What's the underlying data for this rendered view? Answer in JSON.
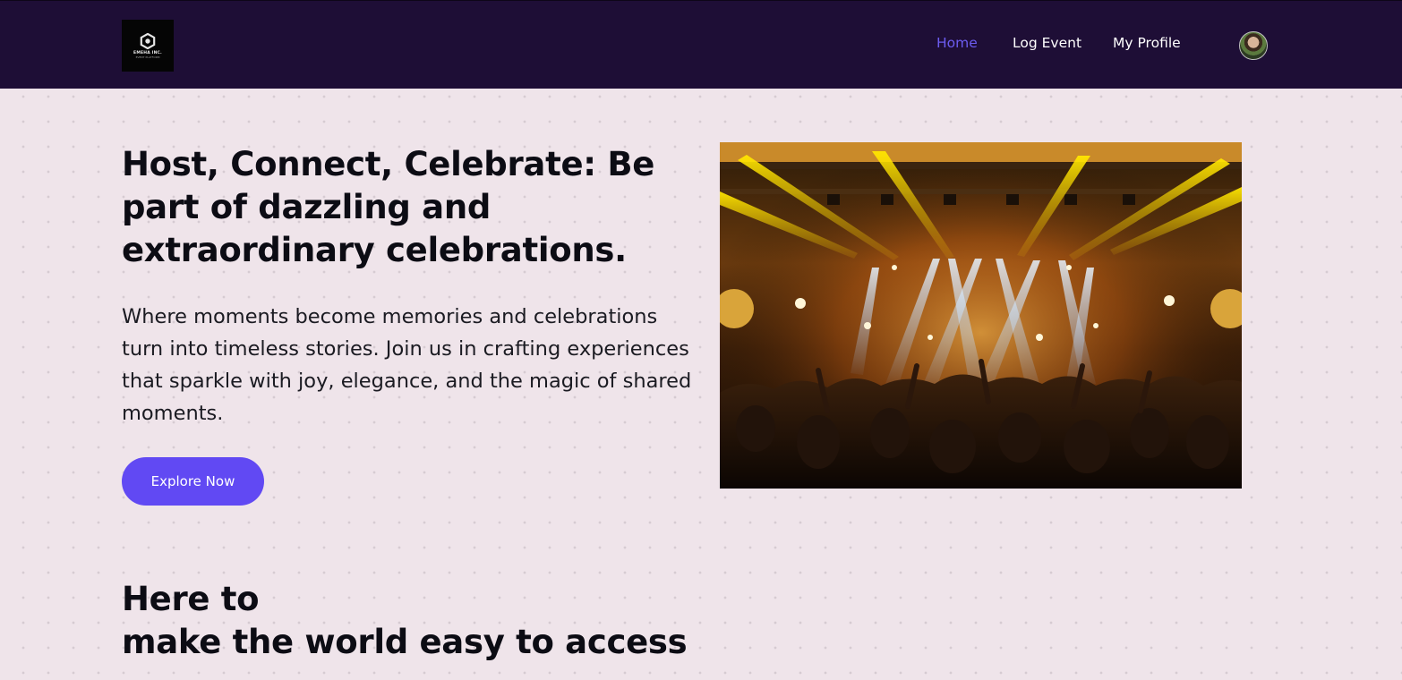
{
  "brand": {
    "logo_name": "EMEHA INC.",
    "logo_tagline": "EVENT PLATFORM"
  },
  "nav": {
    "links": [
      {
        "label": "Home",
        "active": true
      },
      {
        "label": "Log Event",
        "active": false
      },
      {
        "label": "My Profile",
        "active": false
      }
    ]
  },
  "hero": {
    "title": "Host, Connect, Celebrate: Be part of dazzling and extraordinary celebrations.",
    "description": "Where moments become memories and celebrations turn into timeless stories. Join us in crafting experiences that sparkle with joy, elegance, and the magic of shared moments.",
    "cta_label": "Explore Now"
  },
  "section": {
    "title_line1": "Here to",
    "title_line2": "make the world easy to access"
  },
  "colors": {
    "nav_background": "#1e0e36",
    "accent": "#6149f3",
    "active_link": "#6c5cf0",
    "page_background": "#efe4ea"
  },
  "icons": {
    "logo": "hexagon-logo-icon",
    "avatar": "user-avatar"
  }
}
